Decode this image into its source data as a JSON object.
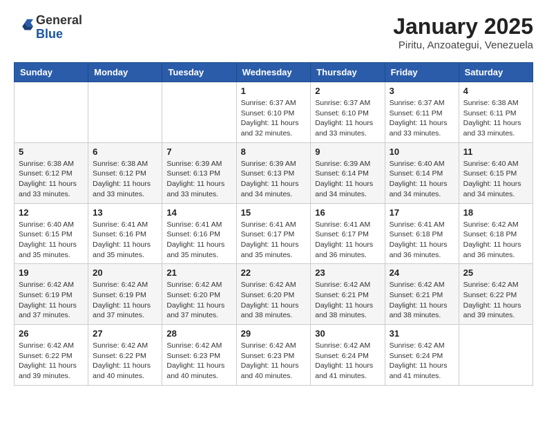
{
  "logo": {
    "general": "General",
    "blue": "Blue"
  },
  "header": {
    "title": "January 2025",
    "subtitle": "Piritu, Anzoategui, Venezuela"
  },
  "weekdays": [
    "Sunday",
    "Monday",
    "Tuesday",
    "Wednesday",
    "Thursday",
    "Friday",
    "Saturday"
  ],
  "weeks": [
    [
      {
        "day": "",
        "info": ""
      },
      {
        "day": "",
        "info": ""
      },
      {
        "day": "",
        "info": ""
      },
      {
        "day": "1",
        "info": "Sunrise: 6:37 AM\nSunset: 6:10 PM\nDaylight: 11 hours\nand 32 minutes."
      },
      {
        "day": "2",
        "info": "Sunrise: 6:37 AM\nSunset: 6:10 PM\nDaylight: 11 hours\nand 33 minutes."
      },
      {
        "day": "3",
        "info": "Sunrise: 6:37 AM\nSunset: 6:11 PM\nDaylight: 11 hours\nand 33 minutes."
      },
      {
        "day": "4",
        "info": "Sunrise: 6:38 AM\nSunset: 6:11 PM\nDaylight: 11 hours\nand 33 minutes."
      }
    ],
    [
      {
        "day": "5",
        "info": "Sunrise: 6:38 AM\nSunset: 6:12 PM\nDaylight: 11 hours\nand 33 minutes."
      },
      {
        "day": "6",
        "info": "Sunrise: 6:38 AM\nSunset: 6:12 PM\nDaylight: 11 hours\nand 33 minutes."
      },
      {
        "day": "7",
        "info": "Sunrise: 6:39 AM\nSunset: 6:13 PM\nDaylight: 11 hours\nand 33 minutes."
      },
      {
        "day": "8",
        "info": "Sunrise: 6:39 AM\nSunset: 6:13 PM\nDaylight: 11 hours\nand 34 minutes."
      },
      {
        "day": "9",
        "info": "Sunrise: 6:39 AM\nSunset: 6:14 PM\nDaylight: 11 hours\nand 34 minutes."
      },
      {
        "day": "10",
        "info": "Sunrise: 6:40 AM\nSunset: 6:14 PM\nDaylight: 11 hours\nand 34 minutes."
      },
      {
        "day": "11",
        "info": "Sunrise: 6:40 AM\nSunset: 6:15 PM\nDaylight: 11 hours\nand 34 minutes."
      }
    ],
    [
      {
        "day": "12",
        "info": "Sunrise: 6:40 AM\nSunset: 6:15 PM\nDaylight: 11 hours\nand 35 minutes."
      },
      {
        "day": "13",
        "info": "Sunrise: 6:41 AM\nSunset: 6:16 PM\nDaylight: 11 hours\nand 35 minutes."
      },
      {
        "day": "14",
        "info": "Sunrise: 6:41 AM\nSunset: 6:16 PM\nDaylight: 11 hours\nand 35 minutes."
      },
      {
        "day": "15",
        "info": "Sunrise: 6:41 AM\nSunset: 6:17 PM\nDaylight: 11 hours\nand 35 minutes."
      },
      {
        "day": "16",
        "info": "Sunrise: 6:41 AM\nSunset: 6:17 PM\nDaylight: 11 hours\nand 36 minutes."
      },
      {
        "day": "17",
        "info": "Sunrise: 6:41 AM\nSunset: 6:18 PM\nDaylight: 11 hours\nand 36 minutes."
      },
      {
        "day": "18",
        "info": "Sunrise: 6:42 AM\nSunset: 6:18 PM\nDaylight: 11 hours\nand 36 minutes."
      }
    ],
    [
      {
        "day": "19",
        "info": "Sunrise: 6:42 AM\nSunset: 6:19 PM\nDaylight: 11 hours\nand 37 minutes."
      },
      {
        "day": "20",
        "info": "Sunrise: 6:42 AM\nSunset: 6:19 PM\nDaylight: 11 hours\nand 37 minutes."
      },
      {
        "day": "21",
        "info": "Sunrise: 6:42 AM\nSunset: 6:20 PM\nDaylight: 11 hours\nand 37 minutes."
      },
      {
        "day": "22",
        "info": "Sunrise: 6:42 AM\nSunset: 6:20 PM\nDaylight: 11 hours\nand 38 minutes."
      },
      {
        "day": "23",
        "info": "Sunrise: 6:42 AM\nSunset: 6:21 PM\nDaylight: 11 hours\nand 38 minutes."
      },
      {
        "day": "24",
        "info": "Sunrise: 6:42 AM\nSunset: 6:21 PM\nDaylight: 11 hours\nand 38 minutes."
      },
      {
        "day": "25",
        "info": "Sunrise: 6:42 AM\nSunset: 6:22 PM\nDaylight: 11 hours\nand 39 minutes."
      }
    ],
    [
      {
        "day": "26",
        "info": "Sunrise: 6:42 AM\nSunset: 6:22 PM\nDaylight: 11 hours\nand 39 minutes."
      },
      {
        "day": "27",
        "info": "Sunrise: 6:42 AM\nSunset: 6:22 PM\nDaylight: 11 hours\nand 40 minutes."
      },
      {
        "day": "28",
        "info": "Sunrise: 6:42 AM\nSunset: 6:23 PM\nDaylight: 11 hours\nand 40 minutes."
      },
      {
        "day": "29",
        "info": "Sunrise: 6:42 AM\nSunset: 6:23 PM\nDaylight: 11 hours\nand 40 minutes."
      },
      {
        "day": "30",
        "info": "Sunrise: 6:42 AM\nSunset: 6:24 PM\nDaylight: 11 hours\nand 41 minutes."
      },
      {
        "day": "31",
        "info": "Sunrise: 6:42 AM\nSunset: 6:24 PM\nDaylight: 11 hours\nand 41 minutes."
      },
      {
        "day": "",
        "info": ""
      }
    ]
  ]
}
